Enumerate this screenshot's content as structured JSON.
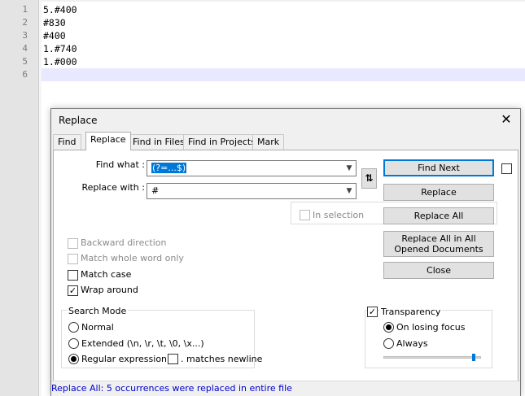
{
  "editor": {
    "line_numbers": [
      "1",
      "2",
      "3",
      "4",
      "5",
      "6"
    ],
    "lines": [
      "5.#400",
      "#830",
      "#400",
      "1.#740",
      "1.#000",
      ""
    ]
  },
  "dialog": {
    "title": "Replace",
    "tabs": [
      "Find",
      "Replace",
      "Find in Files",
      "Find in Projects",
      "Mark"
    ],
    "find_what_label": "Find what :",
    "find_what_value": "(?=...$)",
    "replace_with_label": "Replace with :",
    "replace_with_value": "#",
    "swap_icon": "swap-arrows-icon",
    "buttons": {
      "find_next": "Find Next",
      "replace": "Replace",
      "replace_all": "Replace All",
      "replace_all_opened": "Replace All in All Opened Documents",
      "close": "Close"
    },
    "in_selection": "In selection",
    "options": {
      "backward": "Backward direction",
      "whole_word": "Match whole word only",
      "match_case": "Match case",
      "wrap_around": "Wrap around"
    },
    "search_mode": {
      "title": "Search Mode",
      "normal": "Normal",
      "extended": "Extended (\\n, \\r, \\t, \\0, \\x...)",
      "regex": "Regular expression",
      "matches_newline": ". matches newline"
    },
    "transparency": {
      "title": "Transparency",
      "on_losing_focus": "On losing focus",
      "always": "Always",
      "level": 0.95
    },
    "status": "Replace All: 5 occurrences were replaced in entire file"
  }
}
